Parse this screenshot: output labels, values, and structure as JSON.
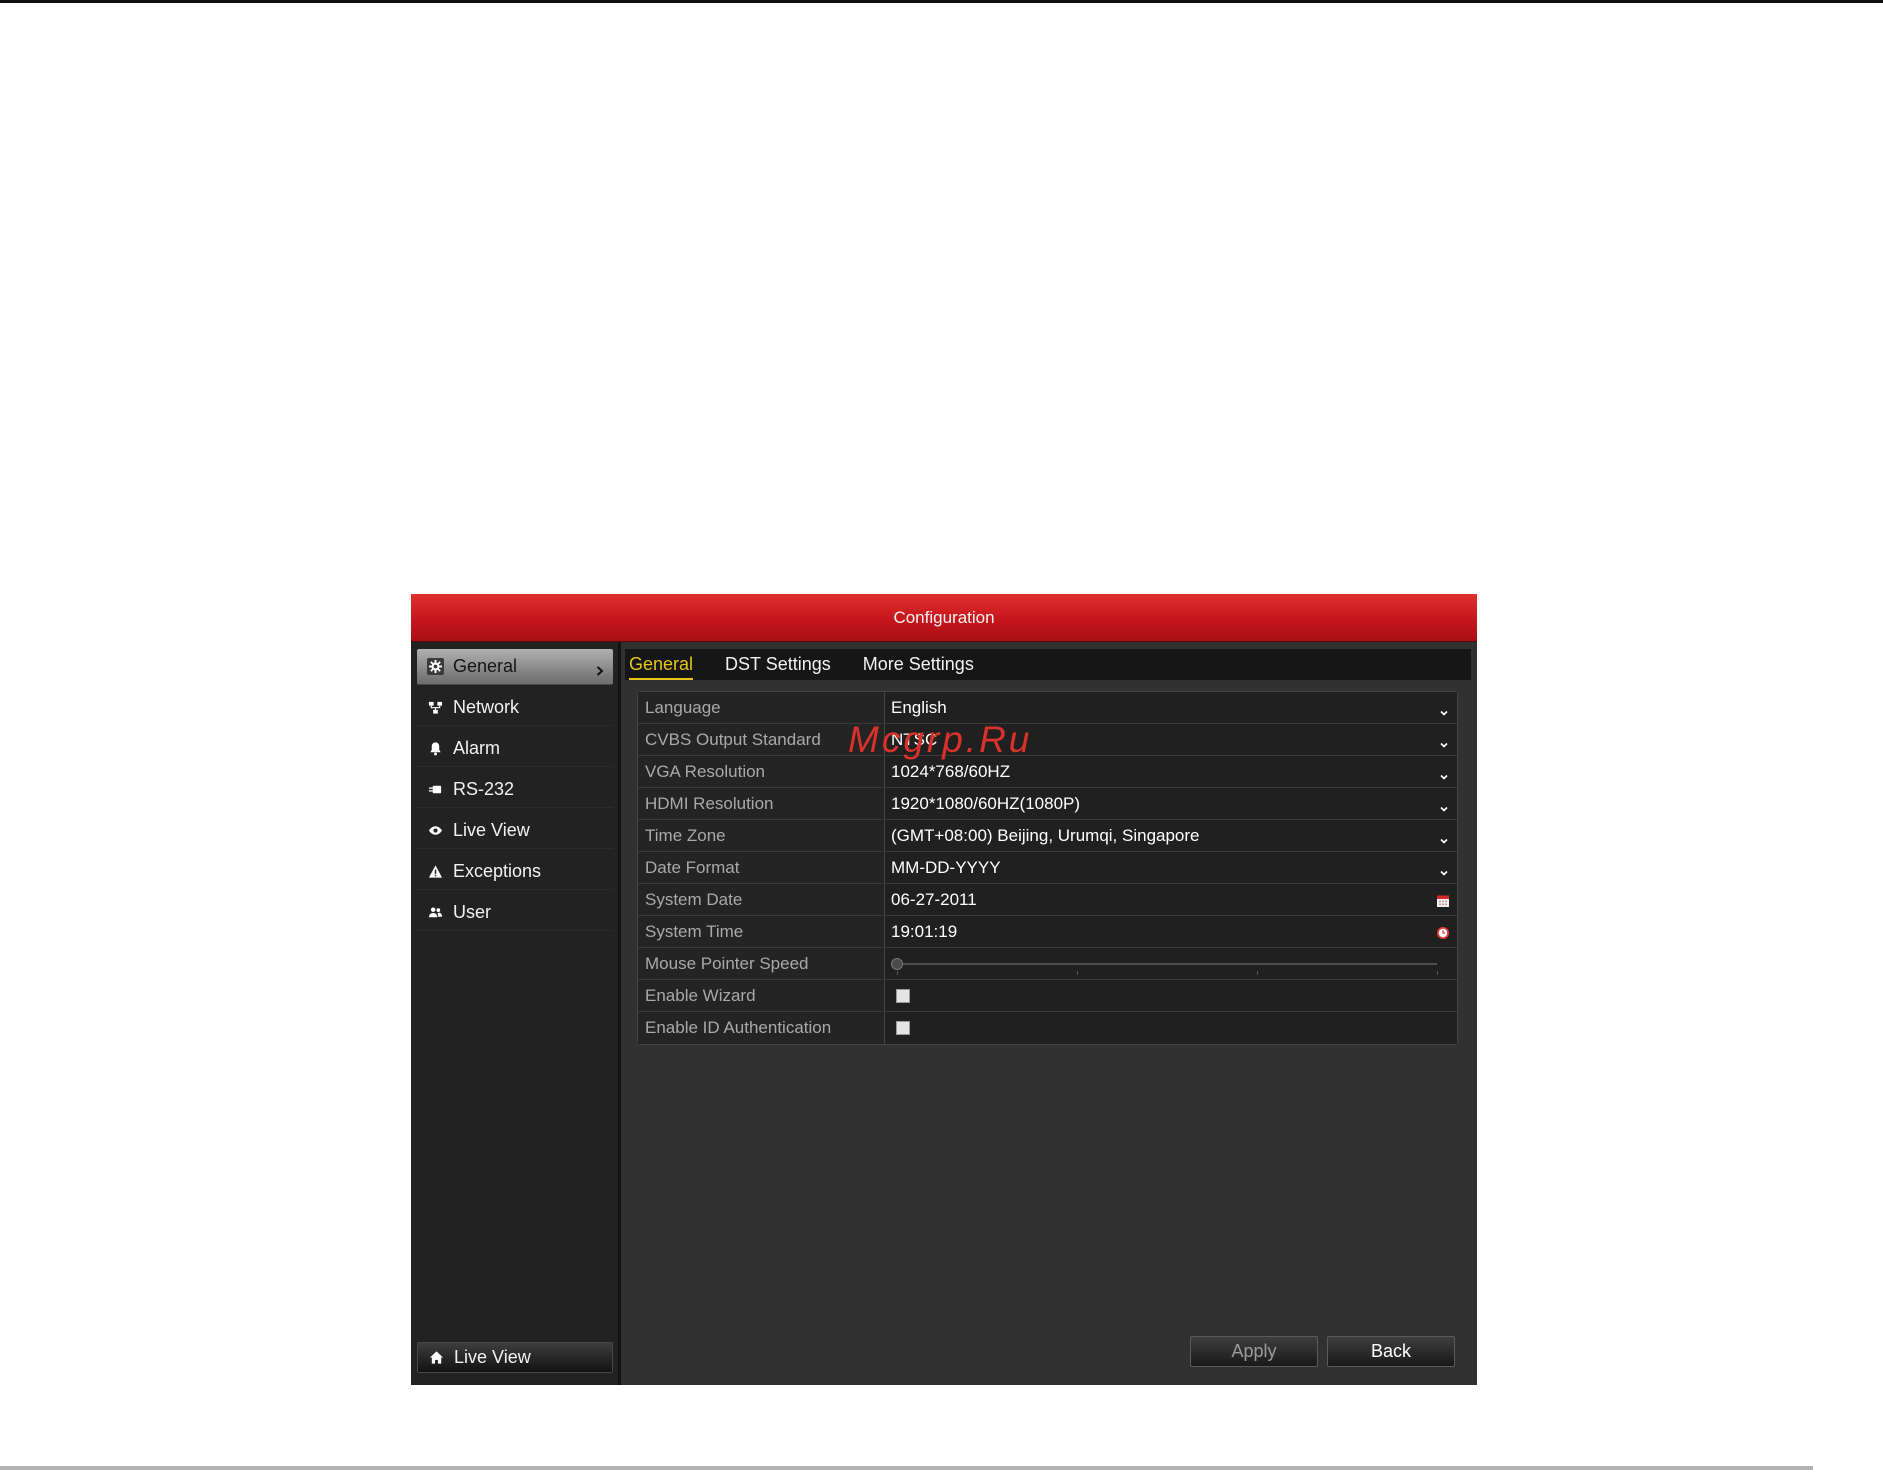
{
  "window": {
    "title": "Configuration"
  },
  "sidebar": {
    "items": [
      {
        "label": "General",
        "icon": "gear-icon",
        "selected": true
      },
      {
        "label": "Network",
        "icon": "network-icon",
        "selected": false
      },
      {
        "label": "Alarm",
        "icon": "alarm-icon",
        "selected": false
      },
      {
        "label": "RS-232",
        "icon": "rs232-icon",
        "selected": false
      },
      {
        "label": "Live View",
        "icon": "eye-icon",
        "selected": false
      },
      {
        "label": "Exceptions",
        "icon": "warning-icon",
        "selected": false
      },
      {
        "label": "User",
        "icon": "users-icon",
        "selected": false
      }
    ],
    "footer_button": {
      "label": "Live View",
      "icon": "home-icon"
    }
  },
  "tabs": [
    {
      "label": "General",
      "active": true
    },
    {
      "label": "DST Settings",
      "active": false
    },
    {
      "label": "More Settings",
      "active": false
    }
  ],
  "form": {
    "rows": [
      {
        "label": "Language",
        "value": "English",
        "icon": "chevron-down-icon"
      },
      {
        "label": "CVBS Output Standard",
        "value": "NTSC",
        "icon": "chevron-down-icon"
      },
      {
        "label": "VGA Resolution",
        "value": "1024*768/60HZ",
        "icon": "chevron-down-icon"
      },
      {
        "label": "HDMI Resolution",
        "value": "1920*1080/60HZ(1080P)",
        "icon": "chevron-down-icon"
      },
      {
        "label": "Time Zone",
        "value": "(GMT+08:00) Beijing, Urumqi, Singapore",
        "icon": "chevron-down-icon"
      },
      {
        "label": "Date Format",
        "value": "MM-DD-YYYY",
        "icon": "chevron-down-icon"
      },
      {
        "label": "System Date",
        "value": "06-27-2011",
        "icon": "calendar-icon"
      },
      {
        "label": "System Time",
        "value": "19:01:19",
        "icon": "clock-icon"
      },
      {
        "label": "Mouse Pointer Speed",
        "level": 0
      },
      {
        "label": "Enable Wizard",
        "checked": false
      },
      {
        "label": "Enable ID Authentication",
        "checked": false
      }
    ]
  },
  "buttons": {
    "apply": "Apply",
    "back": "Back"
  },
  "watermark": "Mcgrp.Ru",
  "colors": {
    "title_bar": "#c5161c",
    "active_tab": "#e6c619",
    "panel_background": "#313131",
    "sidebar_background": "#222222",
    "watermark": "#d9312b"
  }
}
